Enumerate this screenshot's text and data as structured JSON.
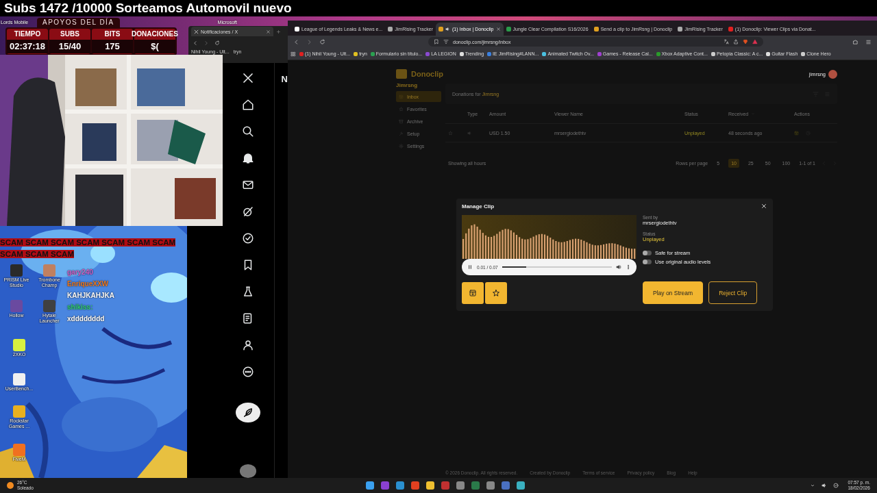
{
  "banner": {
    "text": "Subs 1472 /10000 Sorteamos Automovil nuevo"
  },
  "desktop_top_icons": [
    {
      "label": "Lords Mobile"
    },
    {
      "label": "Microsoft"
    }
  ],
  "stats_panel": {
    "title": "APOYOS DEL DÍA",
    "stats": [
      {
        "label": "TIEMPO",
        "value": "02:37:18"
      },
      {
        "label": "SUBS",
        "value": "15/40"
      },
      {
        "label": "BITS",
        "value": "175"
      },
      {
        "label": "DONACIONES",
        "value": "$("
      }
    ]
  },
  "mini_browser": {
    "tab": "Notificaciones / X",
    "bookmarks": [
      "Nihil Young - Ult...",
      "tryn"
    ]
  },
  "stream_overlay": {
    "alert": "SCAM SCAM SCAM SCAM SCAM SCAM SCAM SCAM SCAM SCAM",
    "chat": [
      {
        "user": "gary240",
        "color": "#d060c8"
      },
      {
        "user": "EnriqueXXW",
        "color": "#f07a20"
      },
      {
        "message": "KAHJKAHJKA"
      },
      {
        "user": "shikiss:",
        "color": "#30d070"
      },
      {
        "message": "xdddddddd"
      }
    ],
    "desktop_icons": [
      "PRISM Live Studio",
      "Trombone Champ",
      "Hollow",
      "Hytale Launcher",
      "2XKO",
      "UserBench...",
      "Rockstar Games ...",
      "FiveM"
    ]
  },
  "x_sidebar": {
    "header": "N"
  },
  "browser": {
    "tabs": [
      {
        "title": "League of Legends Leaks & News e...",
        "selected": false,
        "audio": false
      },
      {
        "title": "JimRising Tracker",
        "selected": false,
        "audio": false
      },
      {
        "title": "(1) Inbox | Donoclip",
        "selected": true,
        "audio": true
      },
      {
        "title": "Jungle Clear Compilation S16/2026",
        "selected": false,
        "audio": false
      },
      {
        "title": "Send a clip to JimRsng | Donoclip",
        "selected": false,
        "audio": false
      },
      {
        "title": "JimRising Tracker",
        "selected": false,
        "audio": false
      },
      {
        "title": "(1) Donoclip: Viewer Clips via Donat...",
        "selected": false,
        "audio": false
      }
    ],
    "address": "donoclip.com/jimrsng/inbox",
    "bookmarks": [
      "(1) Nihil Young - Ult...",
      "tryn",
      "Formulario sin título...",
      "LA LEGION",
      "Trending",
      "IE JimRising#LANN...",
      "Animated Twitch Ov...",
      "Games - Release Cal...",
      "Xbox Adaptive Cont...",
      "Petopia Classic: A c...",
      "Guitar Flash",
      "Clone Hero"
    ]
  },
  "page": {
    "brand": "Donoclip",
    "user": "jimrsng",
    "channel": "Jimrsng",
    "nav": [
      {
        "label": "Inbox",
        "selected": true
      },
      {
        "label": "Favorites",
        "selected": false
      },
      {
        "label": "Archive",
        "selected": false
      },
      {
        "label": "Setup",
        "selected": false
      },
      {
        "label": "Settings",
        "selected": false
      }
    ],
    "card_title": "Donations for",
    "card_channel": "Jimrsng",
    "table": {
      "columns": [
        "Type",
        "Amount",
        "Viewer Name",
        "Status",
        "Received",
        "Actions"
      ],
      "rows": [
        {
          "starred": false,
          "amount": "USD 1.50",
          "viewer": "mrsergiodethtv",
          "status": "Unplayed",
          "received": "48 seconds ago"
        }
      ]
    },
    "footer_note": "Showing all hours",
    "rows_per_page_label": "Rows per page",
    "page_sizes": [
      {
        "label": "5",
        "selected": false
      },
      {
        "label": "10",
        "selected": true
      },
      {
        "label": "25",
        "selected": false
      },
      {
        "label": "50",
        "selected": false
      },
      {
        "label": "100",
        "selected": false
      }
    ],
    "range": "1-1 of 1",
    "footer_links": [
      "© 2026 Donoclip. All rights reserved.",
      "Created by Donoclip",
      "Terms of service",
      "Privacy policy",
      "Blog",
      "Help"
    ]
  },
  "modal": {
    "title": "Manage Clip",
    "sent_by_label": "Sent by",
    "sender": "mrsergiodethtv",
    "status_label": "Status",
    "status": "Unplayed",
    "toggles": [
      {
        "label": "Safe for stream",
        "on": false
      },
      {
        "label": "Use original audio levels",
        "on": false
      }
    ],
    "player": {
      "time": "0.01 / 0.07",
      "level": 0.22,
      "playing": true
    },
    "buttons": [
      {
        "label": "Play on Stream",
        "kind": "primary"
      },
      {
        "label": "Reject Clip",
        "kind": "outline"
      }
    ]
  },
  "taskbar": {
    "temperature": "26°C",
    "weather": "Soleado",
    "time": "07:57 p. m.",
    "date": "18/02/2026"
  }
}
